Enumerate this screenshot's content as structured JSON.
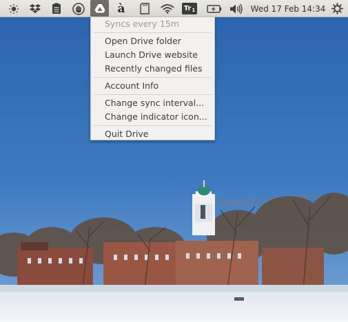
{
  "panel": {
    "icons": [
      {
        "name": "brightness-icon"
      },
      {
        "name": "dropbox-icon"
      },
      {
        "name": "clipboard-icon"
      },
      {
        "name": "hand-icon"
      },
      {
        "name": "google-drive-icon"
      },
      {
        "name": "keyboard-layout-icon",
        "glyph": "à"
      },
      {
        "name": "sd-card-icon"
      },
      {
        "name": "wifi-icon"
      },
      {
        "name": "translate-icon",
        "text": "Tr",
        "sub": "1"
      },
      {
        "name": "battery-icon"
      },
      {
        "name": "volume-icon"
      },
      {
        "name": "power-icon"
      }
    ],
    "clock": "Wed 17 Feb 14:34"
  },
  "menu": {
    "status": "Syncs every 15m",
    "items": [
      "Open Drive folder",
      "Launch Drive website",
      "Recently changed files",
      "Account Info",
      "Change sync interval...",
      "Change indicator icon...",
      "Quit Drive"
    ]
  },
  "colors": {
    "sky_top": "#2d65b1",
    "sky_bottom": "#6f9ed2",
    "snow": "#eef2f6",
    "menu_bg": "#f2f1f0",
    "panel_bg": "#dfded9",
    "active_indicator_bg": "#6f6d68"
  }
}
